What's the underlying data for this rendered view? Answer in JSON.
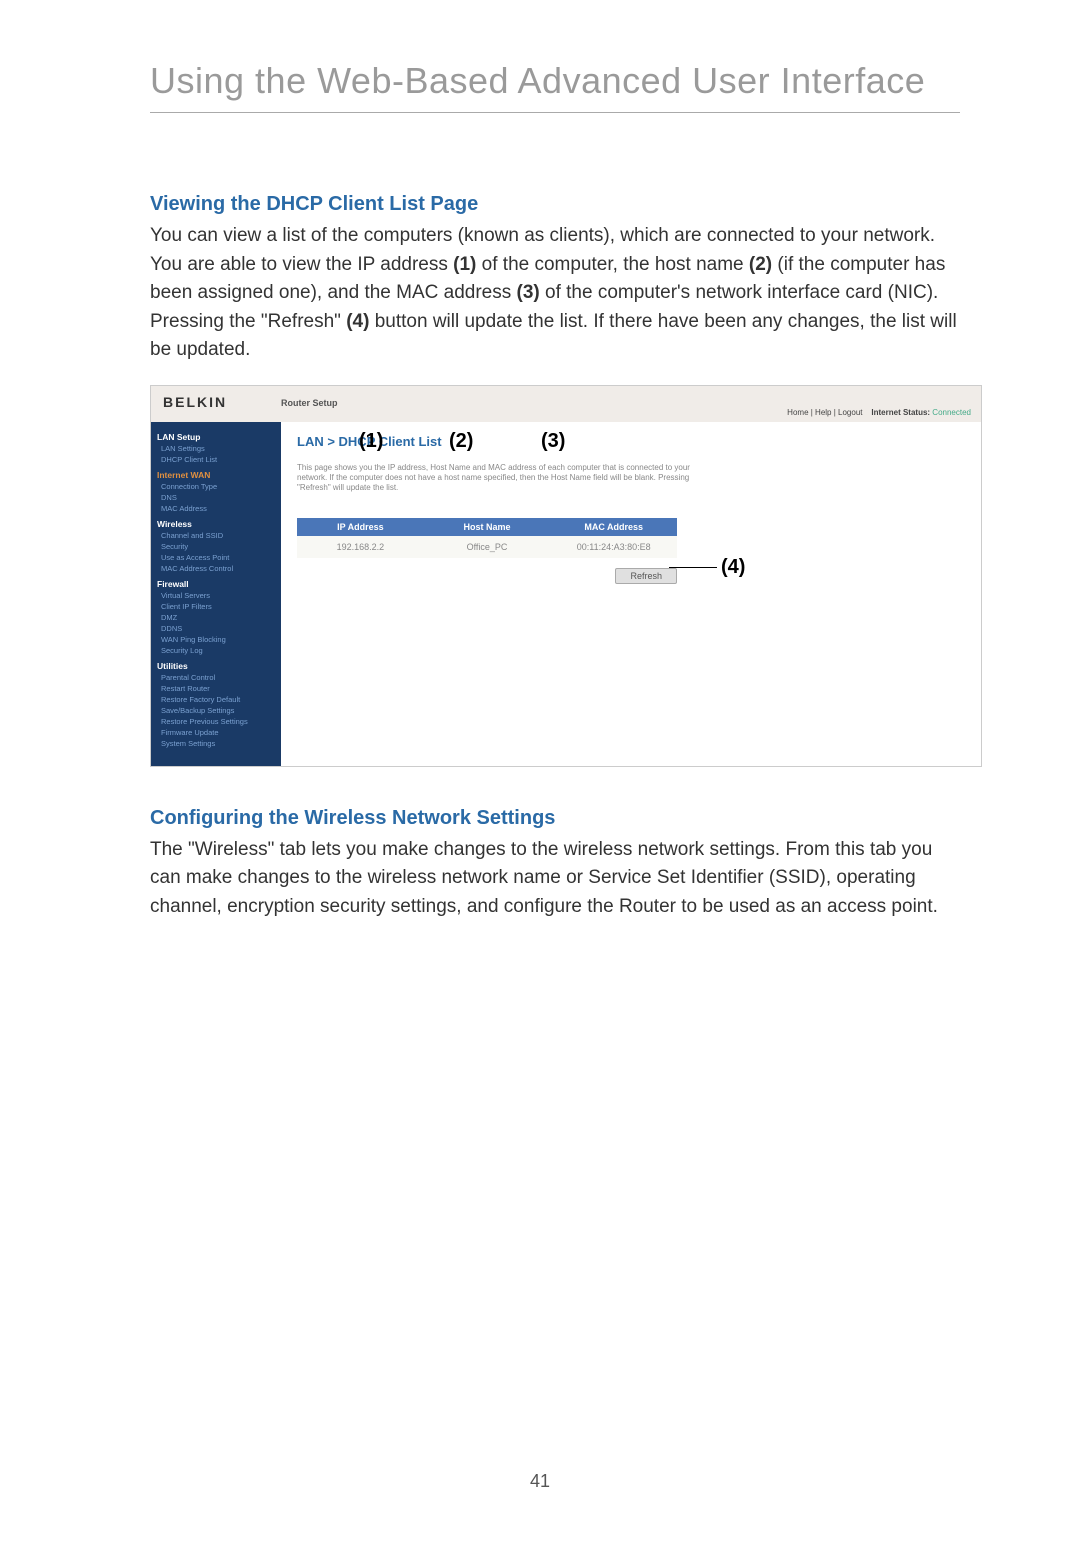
{
  "page_title": "Using the Web-Based Advanced User Interface",
  "page_number": "41",
  "section1": {
    "heading": "Viewing the DHCP Client List Page",
    "body_parts": [
      "You can view a list of the computers (known as clients), which are connected to your network. You are able to view the IP address ",
      "(1)",
      " of the computer, the host name ",
      "(2)",
      " (if the computer has been assigned one), and the MAC address ",
      "(3)",
      " of the computer's network interface card (NIC). Pressing the \"Refresh\" ",
      "(4)",
      " button will update the list. If there have been any changes, the list will be updated."
    ]
  },
  "section2": {
    "heading": "Configuring the Wireless Network Settings",
    "body": "The \"Wireless\" tab lets you make changes to the wireless network settings. From this tab you can make changes to the wireless network name or Service Set Identifier (SSID), operating channel, encryption security settings, and configure the Router to be used as an access point."
  },
  "callouts": {
    "c1": "(1)",
    "c2": "(2)",
    "c3": "(3)",
    "c4": "(4)"
  },
  "screenshot": {
    "brand": "BELKIN",
    "setup_label": "Router Setup",
    "top_right": {
      "home": "Home",
      "help": "Help",
      "logout": "Logout",
      "status_label": "Internet Status:",
      "status_value": "Connected"
    },
    "breadcrumb": "LAN > DHCP Client List",
    "description": "This page shows you the IP address, Host Name and MAC address of each computer that is connected to your network. If the computer does not have a host name specified, then the Host Name field will be blank. Pressing \"Refresh\" will update the list.",
    "table": {
      "headers": [
        "IP Address",
        "Host Name",
        "MAC Address"
      ],
      "row": [
        "192.168.2.2",
        "Office_PC",
        "00:11:24:A3:80:E8"
      ]
    },
    "refresh_label": "Refresh",
    "sidebar": {
      "g1": {
        "head": "LAN Setup",
        "items": [
          "LAN Settings",
          "DHCP Client List"
        ]
      },
      "g2": {
        "head": "Internet WAN",
        "items": [
          "Connection Type",
          "DNS",
          "MAC Address"
        ]
      },
      "g3": {
        "head": "Wireless",
        "items": [
          "Channel and SSID",
          "Security",
          "Use as Access Point",
          "MAC Address Control"
        ]
      },
      "g4": {
        "head": "Firewall",
        "items": [
          "Virtual Servers",
          "Client IP Filters",
          "DMZ",
          "DDNS",
          "WAN Ping Blocking",
          "Security Log"
        ]
      },
      "g5": {
        "head": "Utilities",
        "items": [
          "Parental Control",
          "Restart Router",
          "Restore Factory Default",
          "Save/Backup Settings",
          "Restore Previous Settings",
          "Firmware Update",
          "System Settings"
        ]
      }
    }
  }
}
